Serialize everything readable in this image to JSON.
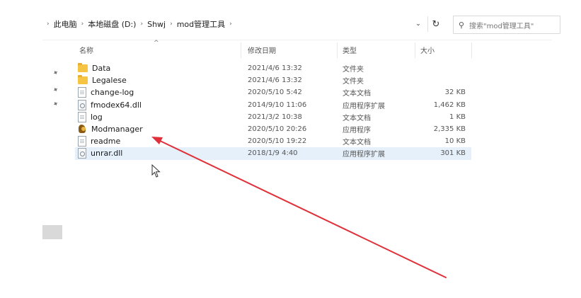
{
  "address_bar": {
    "crumbs": [
      "此电脑",
      "本地磁盘 (D:)",
      "Shwj",
      "mod管理工具"
    ],
    "separator": "›"
  },
  "search": {
    "placeholder": "搜索\"mod管理工具\""
  },
  "columns": {
    "name": "名称",
    "date": "修改日期",
    "type": "类型",
    "size": "大小"
  },
  "files": [
    {
      "name": "Data",
      "date": "2021/4/6 13:32",
      "type": "文件夹",
      "size": "",
      "icon": "folder-icon"
    },
    {
      "name": "Legalese",
      "date": "2021/4/6 13:32",
      "type": "文件夹",
      "size": "",
      "icon": "folder-icon"
    },
    {
      "name": "change-log",
      "date": "2020/5/10 5:42",
      "type": "文本文档",
      "size": "32 KB",
      "icon": "text-file-icon"
    },
    {
      "name": "fmodex64.dll",
      "date": "2014/9/10 11:06",
      "type": "应用程序扩展",
      "size": "1,462 KB",
      "icon": "dll-file-icon"
    },
    {
      "name": "log",
      "date": "2021/3/2 10:38",
      "type": "文本文档",
      "size": "1 KB",
      "icon": "text-file-icon"
    },
    {
      "name": "Modmanager",
      "date": "2020/5/10 20:26",
      "type": "应用程序",
      "size": "2,335 KB",
      "icon": "app-icon"
    },
    {
      "name": "readme",
      "date": "2020/5/10 19:22",
      "type": "文本文档",
      "size": "10 KB",
      "icon": "text-file-icon"
    },
    {
      "name": "unrar.dll",
      "date": "2018/1/9 4:40",
      "type": "应用程序扩展",
      "size": "301 KB",
      "icon": "dll-file-icon"
    }
  ],
  "selected_row": 7,
  "annotation_color": "#e0303a"
}
